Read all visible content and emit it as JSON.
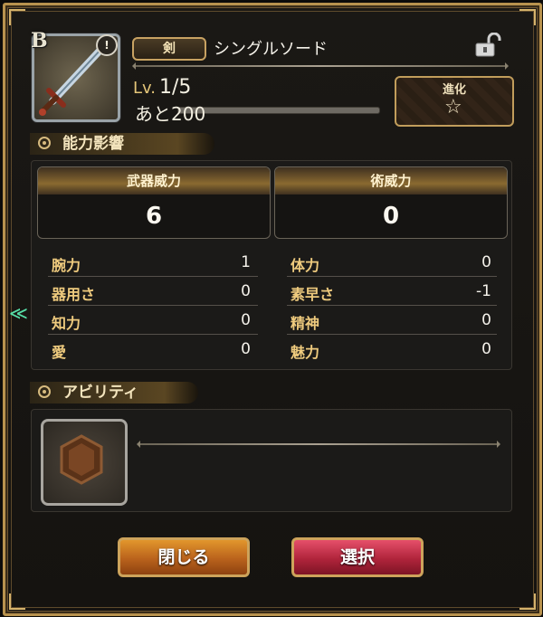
{
  "item": {
    "rank": "B",
    "warning": "!",
    "type": "剣",
    "name": "シングルソード",
    "level_label": "Lv.",
    "level": "1/5",
    "next": "あと200",
    "exp_fraction": 0.0
  },
  "evolution": {
    "label": "進化"
  },
  "ability_influence": {
    "title": "能力影響",
    "weapon_power_label": "武器威力",
    "weapon_power_value": "6",
    "art_power_label": "術威力",
    "art_power_value": "0",
    "stats_left": [
      {
        "label": "腕力",
        "value": "1"
      },
      {
        "label": "器用さ",
        "value": "0"
      },
      {
        "label": "知力",
        "value": "0"
      },
      {
        "label": "愛",
        "value": "0"
      }
    ],
    "stats_right": [
      {
        "label": "体力",
        "value": "0"
      },
      {
        "label": "素早さ",
        "value": "-1"
      },
      {
        "label": "精神",
        "value": "0"
      },
      {
        "label": "魅力",
        "value": "0"
      }
    ]
  },
  "abilities": {
    "title": "アビリティ"
  },
  "buttons": {
    "close": "閉じる",
    "select": "選択"
  },
  "colors": {
    "gold": "#c8a262",
    "close_button": "#c56a1f",
    "select_button": "#c02d47"
  }
}
